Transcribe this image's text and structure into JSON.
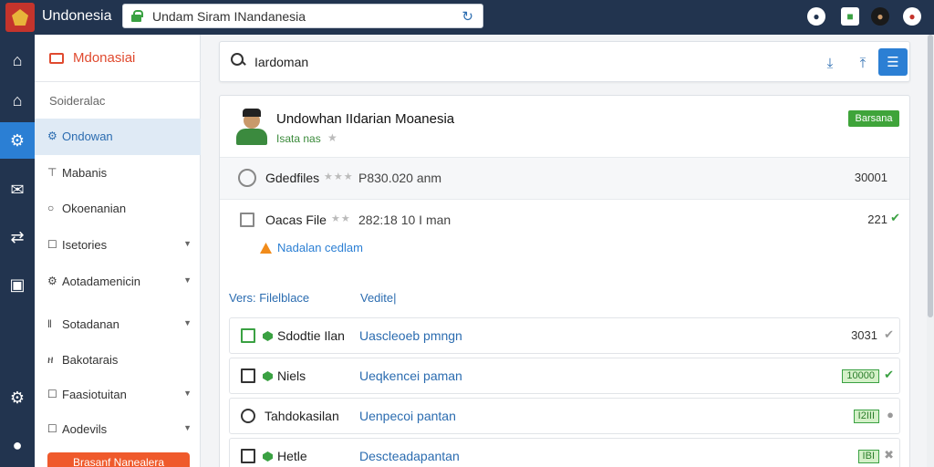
{
  "app": {
    "title": "Undonesia"
  },
  "urlbar": {
    "url": "Undam Siram INandanesia",
    "lock_icon": "lock-icon",
    "reload_icon": "reload-icon"
  },
  "top_icons": [
    {
      "name": "notification-icon",
      "glyph": "●",
      "color": "#ffffff"
    },
    {
      "name": "apps-icon",
      "glyph": "■",
      "color": "#3aa142"
    },
    {
      "name": "user-avatar-icon",
      "glyph": "●",
      "color": "#333333"
    },
    {
      "name": "record-icon",
      "glyph": "●",
      "color": "#c4342c"
    }
  ],
  "rail": [
    {
      "name": "home-icon",
      "glyph": "⌂"
    },
    {
      "name": "house-icon",
      "glyph": "⌂"
    },
    {
      "name": "settings-icon",
      "glyph": "⚙",
      "active": true
    },
    {
      "name": "mail-icon",
      "glyph": "✉"
    },
    {
      "name": "network-icon",
      "glyph": "⇄"
    },
    {
      "name": "calendar-icon",
      "glyph": "▣"
    },
    {
      "name": "gear-icon",
      "glyph": "⚙"
    },
    {
      "name": "profile-icon",
      "glyph": "●"
    }
  ],
  "sidebar": {
    "brand": "Mdonasiai",
    "heading": "Soideralac",
    "items": [
      {
        "label": "Ondowan",
        "icon": "gear-icon",
        "glyph": "⚙",
        "active": true
      },
      {
        "label": "Mabanis",
        "icon": "pin-icon",
        "glyph": "⊤"
      },
      {
        "label": "Okoenanian",
        "icon": "circle-icon",
        "glyph": "○"
      },
      {
        "label": "Isetories",
        "icon": "checkbox-icon",
        "glyph": "☐",
        "caret": true
      },
      {
        "label": "Aotadamenicin",
        "icon": "gear-icon",
        "glyph": "⚙",
        "caret": true
      },
      {
        "label": "Sotadanan",
        "icon": "bar-icon",
        "glyph": "‖",
        "caret": true
      },
      {
        "label": "Bakotarais",
        "icon": "h-icon",
        "glyph": "ዘ"
      },
      {
        "label": "Faasiotuitan",
        "icon": "checkbox-icon",
        "glyph": "☐",
        "caret": true
      },
      {
        "label": "Aodevils",
        "icon": "checkbox-icon",
        "glyph": "☐",
        "caret": true
      }
    ],
    "cta": "Brasanf Nanealera"
  },
  "search": {
    "value": "Iardoman"
  },
  "profile": {
    "name": "Undowhan IIdarian Moanesia",
    "subtitle": "Isata nas",
    "status": "Barsana"
  },
  "files": [
    {
      "name": "Gdedfiles",
      "meta": "P830.020 anm",
      "value": "30001"
    },
    {
      "name": "Oacas File",
      "meta": "282:18 10 I man",
      "value": "221"
    }
  ],
  "warning": "Nadalan cedlam",
  "columns": {
    "left": "Vers: Filelblace",
    "right": "Vedite|"
  },
  "list": [
    {
      "name": "Sdodtie Ilan",
      "desc": "Uascleoeb pmngn",
      "value": "3031",
      "badge": "",
      "bullet": true,
      "icon": "document-icon",
      "icon_style": "green",
      "check": "gray"
    },
    {
      "name": "Niels",
      "desc": "Ueqkencei paman",
      "value": "",
      "badge": "10000",
      "bullet": true,
      "icon": "file-icon",
      "icon_style": "",
      "check": "green"
    },
    {
      "name": "Tahdokasilan",
      "desc": "Uenpecoi pantan",
      "value": "",
      "badge": "I2III",
      "bullet": false,
      "icon": "chat-icon",
      "icon_style": "round",
      "check": "gray"
    },
    {
      "name": "Hetle",
      "desc": "Descteadapantan",
      "value": "",
      "badge": "IBI",
      "bullet": true,
      "icon": "bookmark-icon",
      "icon_style": "",
      "check": "gray"
    }
  ],
  "colors": {
    "brand": "#e04a2f",
    "nav": "#22344f",
    "accent": "#2b7fd4",
    "success": "#3aa142"
  }
}
